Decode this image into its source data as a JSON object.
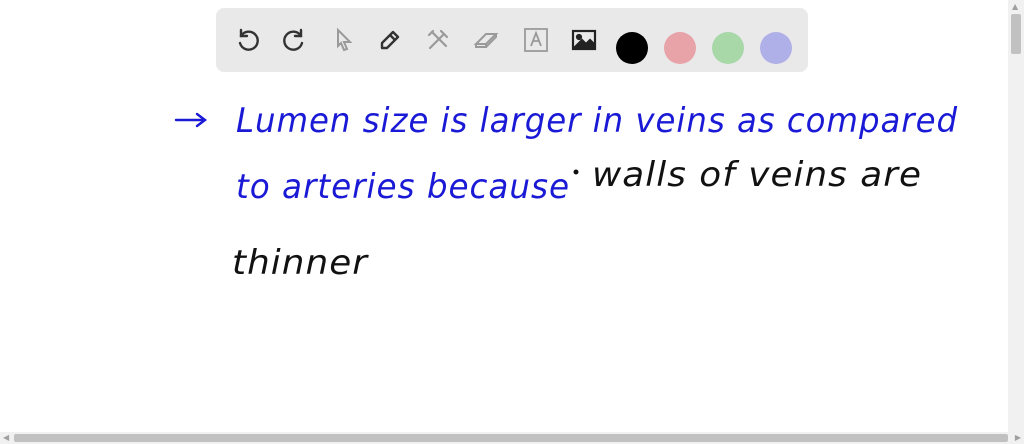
{
  "toolbar": {
    "tools": [
      {
        "name": "undo-icon"
      },
      {
        "name": "redo-icon"
      },
      {
        "name": "select-pointer-icon"
      },
      {
        "name": "pen-icon"
      },
      {
        "name": "tools-icon"
      },
      {
        "name": "eraser-icon"
      },
      {
        "name": "text-box-icon"
      },
      {
        "name": "image-icon"
      }
    ],
    "colors": {
      "black": "#000000",
      "red": "#e8a3a8",
      "green": "#a8d8a8",
      "purple": "#b0b0e8"
    }
  },
  "canvas": {
    "ink_blue": "#1a1ad6",
    "ink_black": "#111111",
    "lines": {
      "line1": "Lumen size is larger in veins as compared",
      "line2_blue": "to arteries because",
      "line2_black": "walls of veins are",
      "line3": "thinner"
    }
  }
}
